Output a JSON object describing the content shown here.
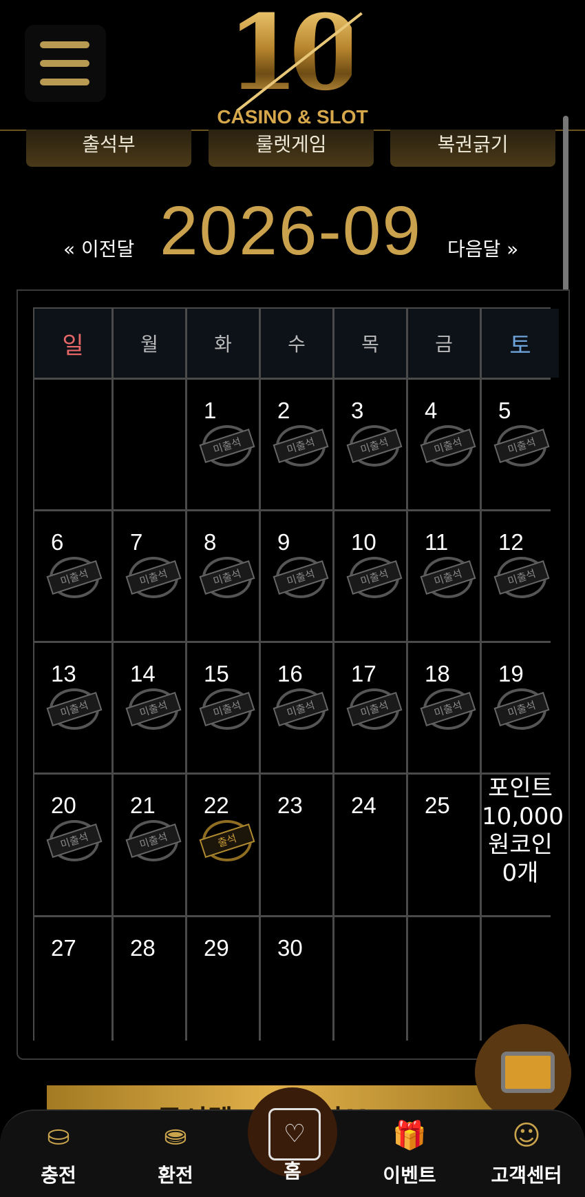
{
  "header": {
    "logo_number": "10",
    "logo_text": "CASINO & SLOT"
  },
  "tabs": [
    "출석부",
    "룰렛게임",
    "복권긁기"
  ],
  "month_nav": {
    "prev": "« 이전달",
    "month": "2026-09",
    "next": "다음달 »"
  },
  "calendar": {
    "weekdays": [
      "일",
      "월",
      "화",
      "수",
      "목",
      "금",
      "토"
    ],
    "stamp_missed": "미출석",
    "stamp_attended": "출석",
    "reward_text": "포인트10,000원코인0개"
  },
  "banner": {
    "text": "공시텔 ... 래 안!!"
  },
  "bottom_nav": [
    {
      "label": "충전",
      "icon": "deposit-icon"
    },
    {
      "label": "환전",
      "icon": "withdraw-icon"
    },
    {
      "label": "홈",
      "icon": "home-heart-icon"
    },
    {
      "label": "이벤트",
      "icon": "gift-icon"
    },
    {
      "label": "고객센터",
      "icon": "support-icon"
    }
  ],
  "colors": {
    "gold": "#caa24d",
    "sunday": "#e66767",
    "saturday": "#6ea2da"
  }
}
